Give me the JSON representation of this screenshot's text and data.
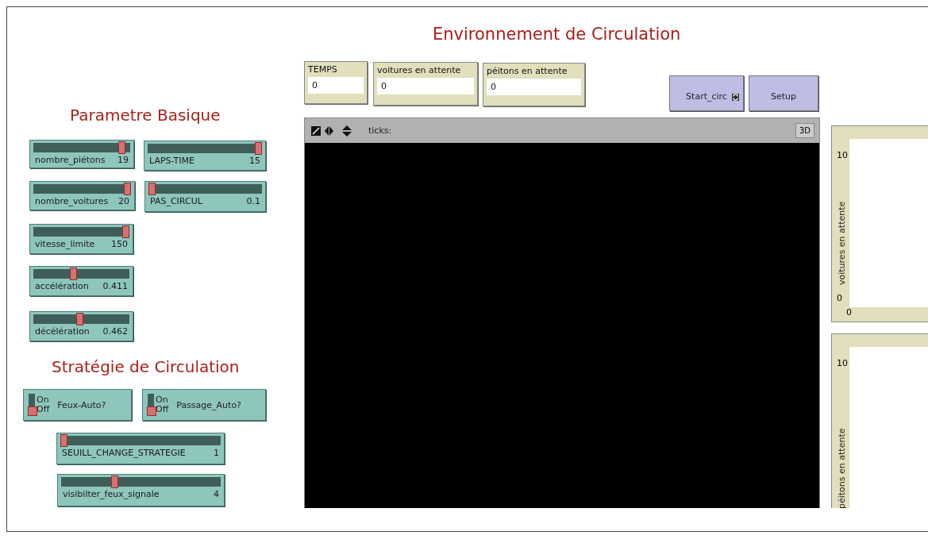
{
  "title": "Environnement de Circulation",
  "sections": [
    {
      "heading": "Parametre Basique"
    },
    {
      "heading": "Stratégie de Circulation"
    }
  ],
  "sliders": [
    {
      "label": "nombre_piétons",
      "value": "19",
      "level": 0.95
    },
    {
      "label": "LAPS-TIME",
      "value": "15",
      "level": 1
    },
    {
      "label": "nombre_voitures",
      "value": "20",
      "level": 1
    },
    {
      "label": "PAS_CIRCUL",
      "value": "0.1",
      "level": 0
    },
    {
      "label": "vitesse_limite",
      "value": "150",
      "level": 1
    },
    {
      "label": "accélération",
      "value": "0.411",
      "level": 0.41
    },
    {
      "label": "décélération",
      "value": "0.462",
      "level": 0.48
    },
    {
      "label": "SEUILL_CHANGE_STRATEGIE",
      "value": "1",
      "level": 0
    },
    {
      "label": "visibilter_feux_signale",
      "value": "4",
      "level": 0.33
    }
  ],
  "switches": [
    {
      "label": "Feux-Auto?",
      "on_text": "On",
      "off_text": "Off",
      "on": false
    },
    {
      "label": "Passage_Auto?",
      "on_text": "On",
      "off_text": "Off",
      "on": false
    }
  ],
  "monitors": [
    {
      "label": "TEMPS",
      "value": "0"
    },
    {
      "label": "voitures en attente",
      "value": "0"
    },
    {
      "label": "péitons en attente",
      "value": "0"
    }
  ],
  "buttons": [
    {
      "label": "Start_circ",
      "forever": true
    },
    {
      "label": "Setup",
      "forever": false
    }
  ],
  "view": {
    "ticks_label": "ticks:",
    "button_3d": "3D"
  },
  "plots": [
    {
      "ylabel": "voitures en attente",
      "ymax": "10",
      "ymin": "0",
      "xmin": "0"
    },
    {
      "ylabel": "péitons en attente",
      "ymax": "10"
    }
  ]
}
